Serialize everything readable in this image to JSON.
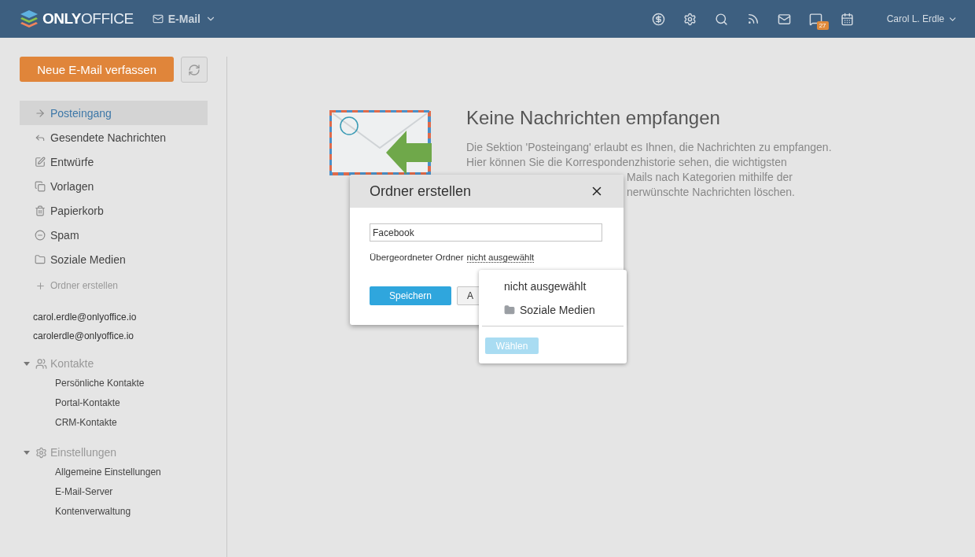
{
  "header": {
    "brand_strong": "ONLY",
    "brand_light": "OFFICE",
    "module": "E-Mail",
    "badge": "27",
    "user": "Carol L. Erdle"
  },
  "sidebar": {
    "compose": "Neue E-Mail verfassen",
    "folders": [
      {
        "label": "Posteingang",
        "selected": true
      },
      {
        "label": "Gesendete Nachrichten",
        "selected": false
      },
      {
        "label": "Entwürfe",
        "selected": false
      },
      {
        "label": "Vorlagen",
        "selected": false
      },
      {
        "label": "Papierkorb",
        "selected": false
      },
      {
        "label": "Spam",
        "selected": false
      },
      {
        "label": "Soziale Medien",
        "selected": false
      }
    ],
    "create_folder": "Ordner erstellen",
    "accounts": [
      "carol.erdle@onlyoffice.io",
      "carolerdle@onlyoffice.io"
    ],
    "groups": [
      {
        "label": "Kontakte",
        "expanded": true,
        "children": [
          {
            "label": "Persönliche Kontakte"
          },
          {
            "label": "Portal-Kontakte"
          },
          {
            "label": "CRM-Kontakte"
          }
        ]
      },
      {
        "label": "Einstellungen",
        "expanded": true,
        "children": [
          {
            "label": "Allgemeine Einstellungen"
          },
          {
            "label": "E-Mail-Server"
          },
          {
            "label": "Kontenverwaltung"
          }
        ]
      }
    ]
  },
  "empty_state": {
    "title": "Keine Nachrichten empfangen",
    "lines": [
      "Die Sektion 'Posteingang' erlaubt es Ihnen, die Nachrichten zu empfangen.",
      "Hier können Sie die Korrespondenzhistorie sehen, die wichtigsten"
    ],
    "covered_lines": [
      "Mails nach Kategorien mithilfe der",
      "nerwünschte Nachrichten löschen."
    ]
  },
  "dialog": {
    "title": "Ordner erstellen",
    "name_value": "Facebook",
    "parent_label": "Übergeordneter Ordner",
    "parent_value": "nicht ausgewählt",
    "save": "Speichern",
    "cancel": "A"
  },
  "dropdown": {
    "options": [
      {
        "label": "nicht ausgewählt",
        "kind": "none"
      },
      {
        "label": "Soziale Medien",
        "kind": "folder"
      }
    ],
    "choose": "Wählen",
    "choose_disabled": true
  }
}
